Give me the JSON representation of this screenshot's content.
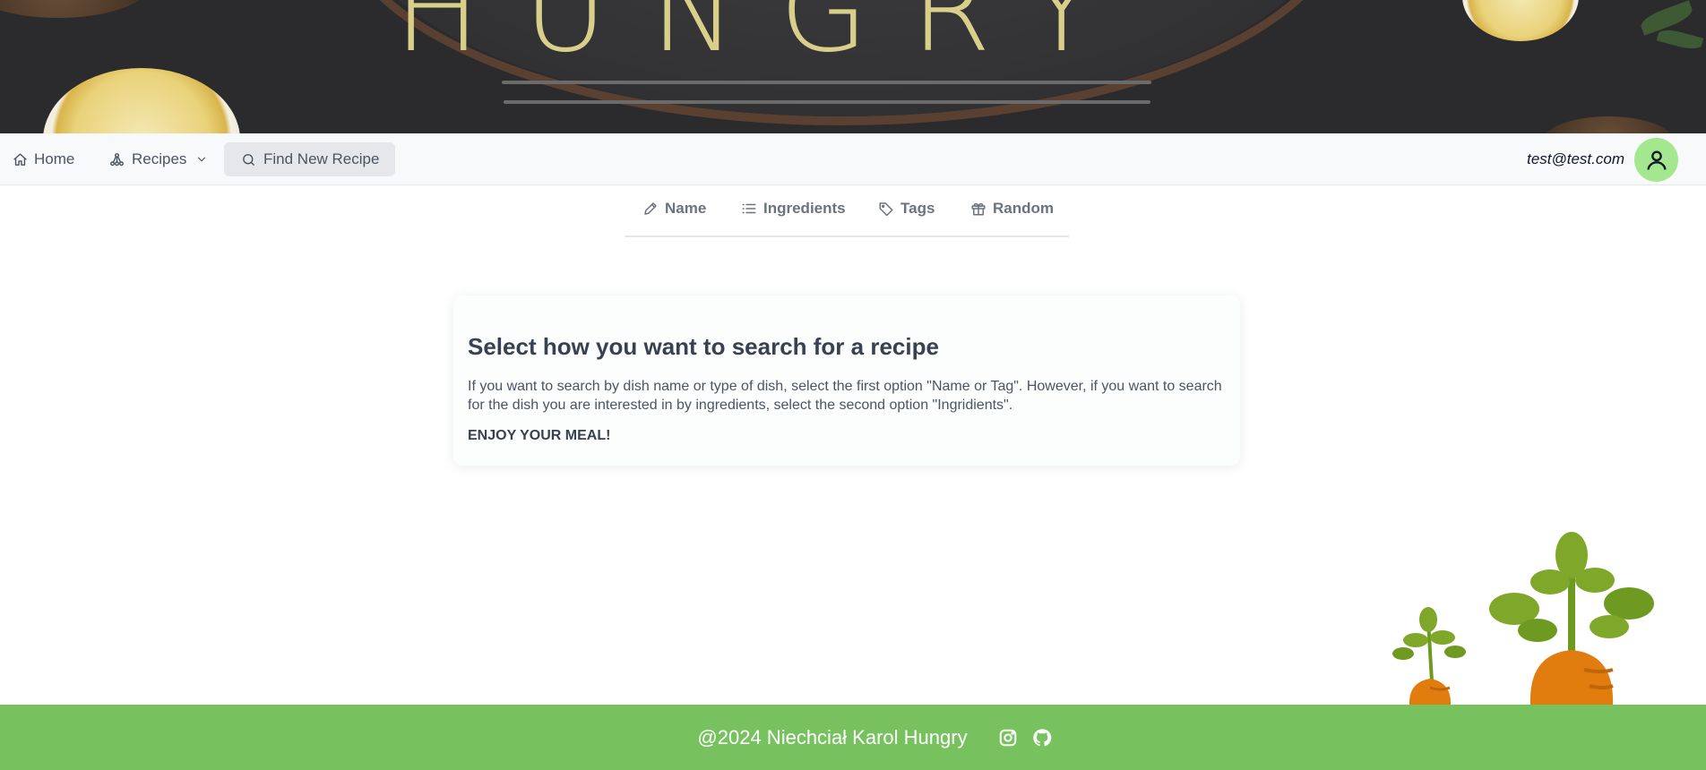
{
  "banner": {
    "logo_text": "HUNGRY"
  },
  "navbar": {
    "home_label": "Home",
    "recipes_label": "Recipes",
    "find_label": "Find New Recipe",
    "user_email": "test@test.com"
  },
  "tabs": [
    {
      "label": "Name",
      "icon": "pencil-icon"
    },
    {
      "label": "Ingredients",
      "icon": "list-icon"
    },
    {
      "label": "Tags",
      "icon": "tag-icon"
    },
    {
      "label": "Random",
      "icon": "gift-icon"
    }
  ],
  "card": {
    "title": "Select how you want to search for a recipe",
    "body": "If you want to search by dish name or type of dish, select the first option \"Name or Tag\". However, if you want to search for the dish you are interested in by ingredients, select the second option \"Ingridients\".",
    "enjoy": "ENJOY YOUR MEAL!"
  },
  "footer": {
    "copyright": "@2024 Niechciał Karol Hungry",
    "icons": [
      "instagram-icon",
      "github-icon"
    ]
  },
  "colors": {
    "navbar_bg": "#f8f9fa",
    "active_nav_bg": "#e5e7eb",
    "avatar_bg": "#a3e88f",
    "footer_bg": "#77c25f",
    "banner_bg": "#2b2b2d"
  }
}
